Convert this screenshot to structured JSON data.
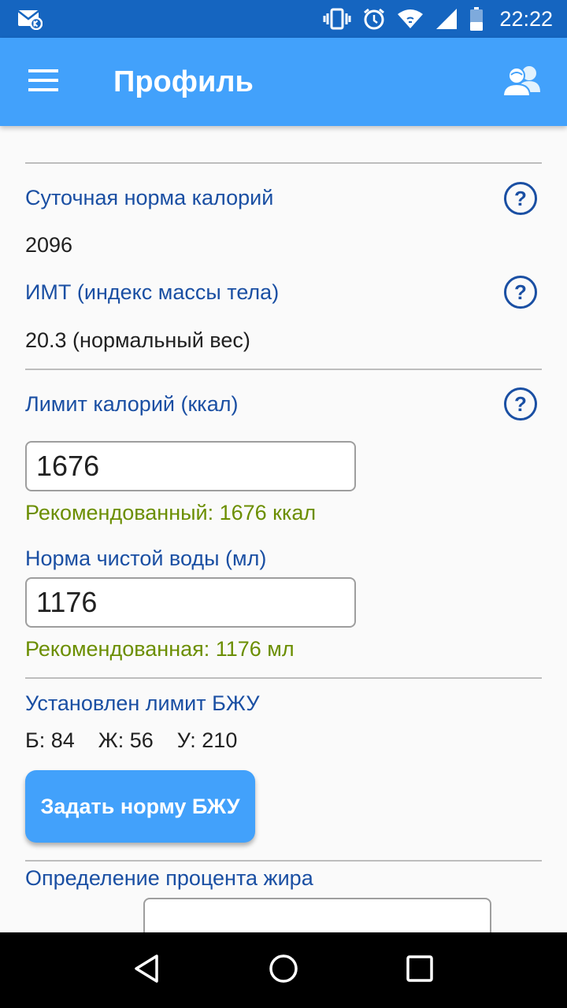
{
  "status_bar": {
    "time": "22:22",
    "icons": [
      "mail-notification-icon",
      "vibrate-icon",
      "alarm-icon",
      "wifi-icon",
      "signal-icon",
      "battery-icon"
    ]
  },
  "app_bar": {
    "title": "Профиль",
    "menu_icon": "hamburger-menu-icon",
    "profile_icon": "users-icon",
    "color": "#42a1fb"
  },
  "daily_calories": {
    "label": "Суточная норма калорий",
    "value": "2096"
  },
  "bmi": {
    "label": "ИМТ (индекс массы тела)",
    "value": "20.3 (нормальный вес)"
  },
  "calorie_limit": {
    "label": "Лимит калорий (ккал)",
    "input_value": "1676",
    "recommended": "Рекомендованный: 1676 ккал"
  },
  "water_norm": {
    "label": "Норма чистой воды (мл)",
    "input_value": "1176",
    "recommended": "Рекомендованная: 1176 мл"
  },
  "bju": {
    "label": "Установлен лимит БЖУ",
    "protein": "Б: 84",
    "fat": "Ж: 56",
    "carbs": "У: 210",
    "button_label": "Задать норму БЖУ"
  },
  "fat_percent": {
    "label": "Определение процента жира"
  },
  "help_glyph": "?",
  "colors": {
    "status_bar": "#1565c0",
    "label_blue": "#1a4fa3",
    "hint_green": "#6b8e00"
  }
}
